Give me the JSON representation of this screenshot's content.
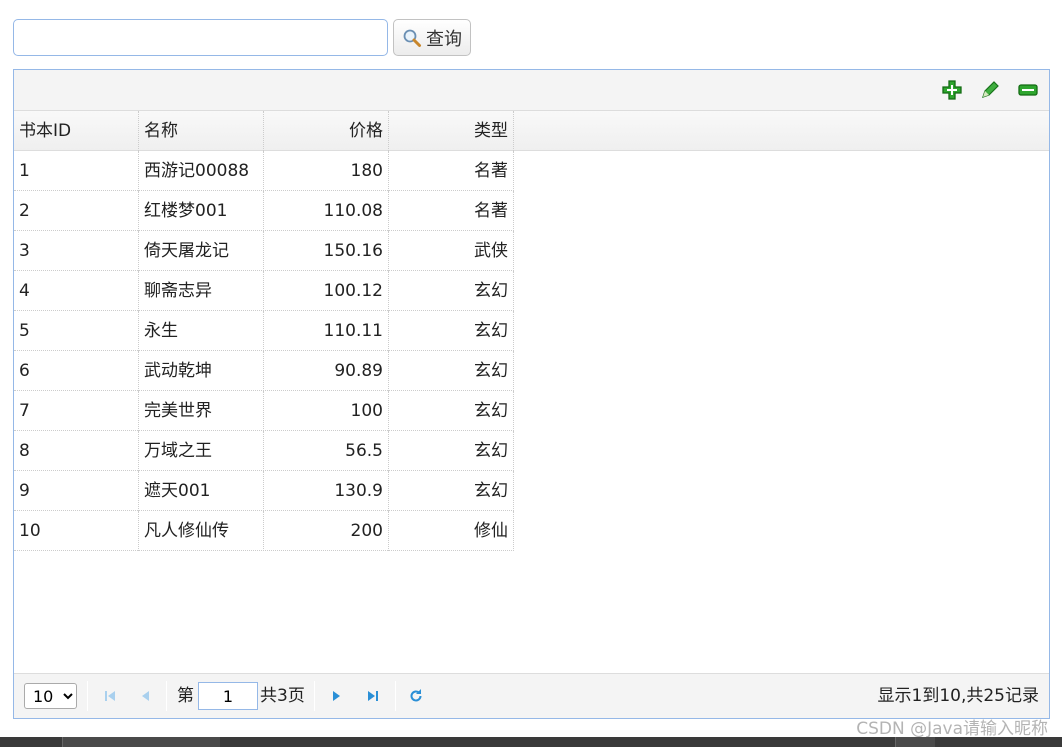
{
  "search": {
    "value": "",
    "placeholder": "",
    "button_label": "查询"
  },
  "toolbar": {
    "add_icon": "add-icon",
    "edit_icon": "pencil-icon",
    "remove_icon": "remove-icon",
    "accent_color": "#1f9a1f"
  },
  "table": {
    "columns": [
      "书本ID",
      "名称",
      "价格",
      "类型"
    ],
    "rows": [
      [
        "1",
        "西游记00088",
        "180",
        "名著"
      ],
      [
        "2",
        "红楼梦001",
        "110.08",
        "名著"
      ],
      [
        "3",
        "倚天屠龙记",
        "150.16",
        "武侠"
      ],
      [
        "4",
        "聊斋志异",
        "100.12",
        "玄幻"
      ],
      [
        "5",
        "永生",
        "110.11",
        "玄幻"
      ],
      [
        "6",
        "武动乾坤",
        "90.89",
        "玄幻"
      ],
      [
        "7",
        "完美世界",
        "100",
        "玄幻"
      ],
      [
        "8",
        "万域之王",
        "56.5",
        "玄幻"
      ],
      [
        "9",
        "遮天001",
        "130.9",
        "玄幻"
      ],
      [
        "10",
        "凡人修仙传",
        "200",
        "修仙"
      ]
    ]
  },
  "pager": {
    "page_size": "10",
    "page_label_prefix": "第",
    "page_number": "1",
    "page_label_suffix": "共3页",
    "info": "显示1到10,共25记录",
    "icon_color": "#2a8fd6"
  },
  "watermark": "CSDN @Java请输入昵称"
}
